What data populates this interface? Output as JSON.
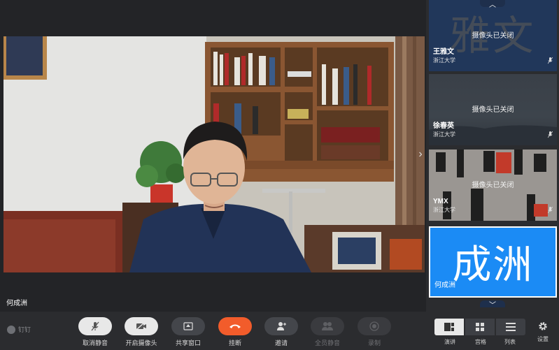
{
  "stage": {
    "speaker_name": "何成洲",
    "next_arrow": "›"
  },
  "participants": [
    {
      "bg_text": "雅文",
      "camera_status": "摄像头已关闭",
      "name": "王雅文",
      "org": "浙江大学"
    },
    {
      "bg_text": "",
      "camera_status": "摄像头已关闭",
      "name": "徐春英",
      "org": "浙江大学"
    },
    {
      "bg_text": "",
      "camera_status": "摄像头已关闭",
      "name": "YMX",
      "org": "浙江大学"
    },
    {
      "bg_text": "成洲",
      "camera_status": "",
      "name": "何成洲",
      "org": ""
    }
  ],
  "scroll": {
    "up": "︿",
    "down": "﹀"
  },
  "toolbar": {
    "brand": "钉钉",
    "buttons": {
      "unmute": "取消静音",
      "camera_on": "开启摄像头",
      "share": "共享窗口",
      "hangup": "挂断",
      "invite": "邀请",
      "mute_all": "全员静音",
      "record": "录制"
    },
    "views": {
      "speaker": "演讲",
      "grid": "宫格",
      "list": "列表"
    },
    "settings": "设置"
  },
  "colors": {
    "accent": "#1b8bf5",
    "hangup": "#f25c2b",
    "background": "#2b2c2f"
  },
  "icons": [
    "mic-muted-icon",
    "camera-off-icon",
    "share-screen-icon",
    "hangup-icon",
    "invite-icon",
    "mute-all-icon",
    "record-icon",
    "speaker-view-icon",
    "grid-view-icon",
    "list-view-icon",
    "gear-icon"
  ]
}
